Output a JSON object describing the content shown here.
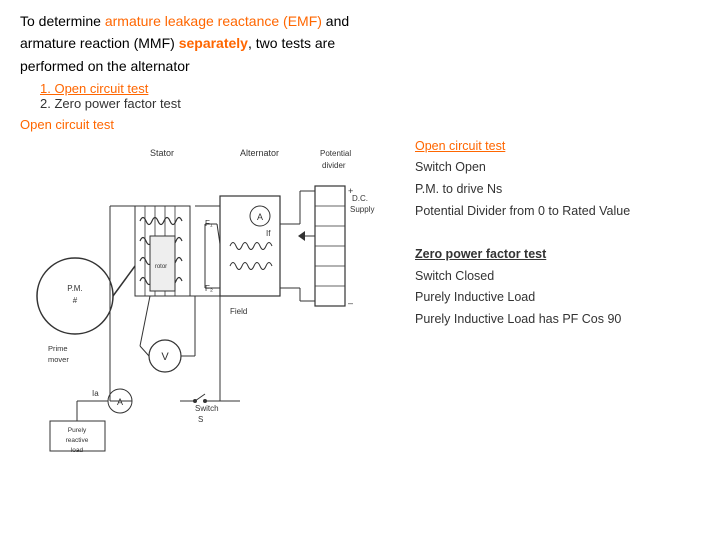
{
  "intro": {
    "line1_part1": "To  determine ",
    "line1_armature": "armature  leakage  reactance  (EMF)",
    "line1_and": " and",
    "line2_part1": "armature  reaction  (MMF) ",
    "line2_separately": "separately",
    "line2_part2": ",  two  tests  are",
    "line3": "performed on the alternator"
  },
  "list": {
    "item1": "1. Open circuit test",
    "item2": "2. Zero power factor test"
  },
  "open_circuit_label": "Open circuit test",
  "right_panel": {
    "oct_title": "Open circuit test",
    "oct_line1": "Switch Open",
    "oct_line2": "P.M. to drive Ns",
    "oct_line3": "Potential Divider from 0 to Rated Value",
    "zpf_title": "Zero power factor test",
    "zpf_line1": "Switch Closed",
    "zpf_line2": "Purely Inductive Load",
    "zpf_line3": "Purely Inductive Load  has PF Cos 90"
  }
}
